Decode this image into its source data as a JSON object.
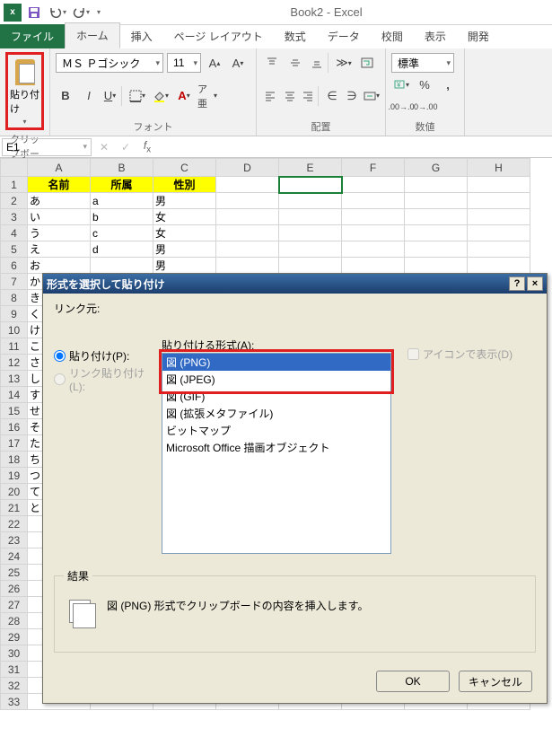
{
  "window": {
    "title": "Book2 - Excel"
  },
  "qat": {
    "save": "保存",
    "undo": "元に戻す",
    "redo": "やり直し"
  },
  "tabs": {
    "file": "ファイル",
    "home": "ホーム",
    "insert": "挿入",
    "layout": "ページ レイアウト",
    "formulas": "数式",
    "data": "データ",
    "review": "校閲",
    "view": "表示",
    "developer": "開発"
  },
  "ribbon": {
    "clipboard": {
      "paste": "貼り付け",
      "label": "クリップボード"
    },
    "font": {
      "name": "ＭＳ Ｐゴシック",
      "size": "11",
      "label": "フォント"
    },
    "align": {
      "label": "配置"
    },
    "number": {
      "combo": "標準",
      "label": "数値"
    }
  },
  "namebox": "E1",
  "columns": [
    "A",
    "B",
    "C",
    "D",
    "E",
    "F",
    "G",
    "H"
  ],
  "row_headers": [
    "1",
    "2",
    "3",
    "4",
    "5",
    "6",
    "7",
    "8",
    "9",
    "10",
    "11",
    "12",
    "13",
    "14",
    "15",
    "16",
    "17",
    "18",
    "19",
    "20",
    "21",
    "22",
    "23",
    "24",
    "25",
    "26",
    "27",
    "28",
    "29",
    "30",
    "31",
    "32",
    "33"
  ],
  "sheet": {
    "header": [
      "名前",
      "所属",
      "性別"
    ],
    "rows": [
      [
        "あ",
        "a",
        "男"
      ],
      [
        "い",
        "b",
        "女"
      ],
      [
        "う",
        "c",
        "女"
      ],
      [
        "え",
        "d",
        "男"
      ],
      [
        "お",
        "",
        "男"
      ],
      [
        "か",
        "",
        ""
      ],
      [
        "き",
        "",
        ""
      ],
      [
        "く",
        "",
        ""
      ],
      [
        "け",
        "",
        ""
      ],
      [
        "こ",
        "",
        ""
      ],
      [
        "さ",
        "",
        ""
      ],
      [
        "し",
        "",
        ""
      ],
      [
        "す",
        "",
        ""
      ],
      [
        "せ",
        "",
        ""
      ],
      [
        "そ",
        "",
        ""
      ],
      [
        "た",
        "",
        ""
      ],
      [
        "ち",
        "",
        ""
      ],
      [
        "つ",
        "",
        ""
      ],
      [
        "て",
        "",
        ""
      ],
      [
        "と",
        "",
        ""
      ]
    ]
  },
  "dialog": {
    "title": "形式を選択して貼り付け",
    "source_label": "リンク元:",
    "format_label": "貼り付ける形式(A):",
    "paste_radio": "貼り付け(P):",
    "pastelink_radio": "リンク貼り付け(L):",
    "icon_checkbox": "アイコンで表示(D)",
    "formats": [
      "図 (PNG)",
      "図 (JPEG)",
      "図 (GIF)",
      "図 (拡張メタファイル)",
      "ビットマップ",
      "Microsoft Office 描画オブジェクト"
    ],
    "result_label": "結果",
    "result_text": "図 (PNG) 形式でクリップボードの内容を挿入します。",
    "ok": "OK",
    "cancel": "キャンセル",
    "help": "?",
    "close": "×"
  }
}
